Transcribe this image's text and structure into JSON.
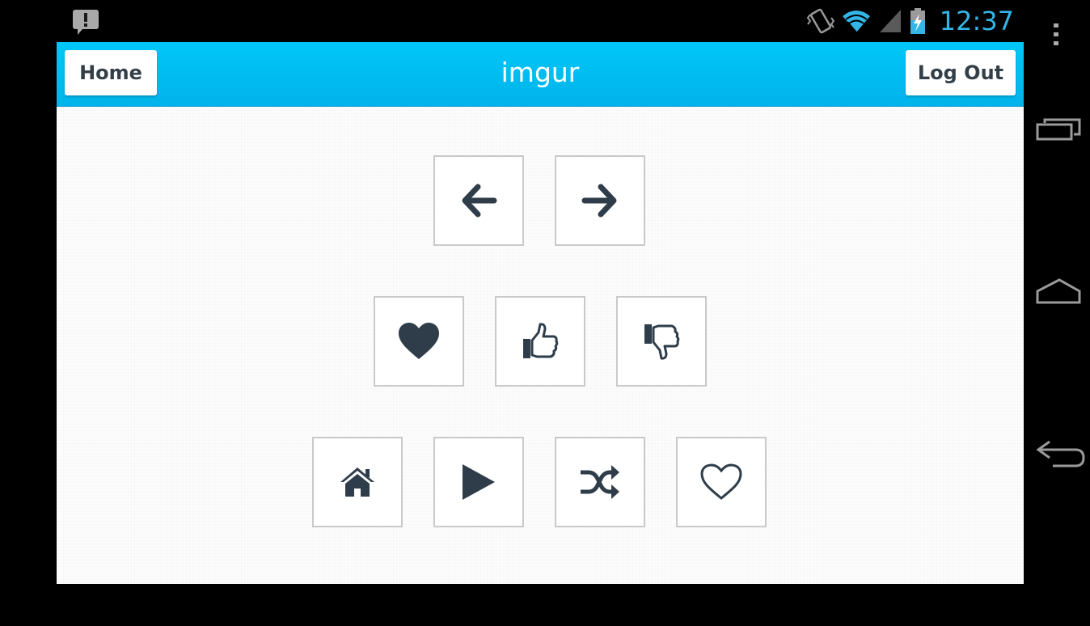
{
  "status_bar": {
    "time": "12:37",
    "accent_color": "#33b5e5",
    "icons": [
      "notification-alert-icon",
      "vibrate-icon",
      "wifi-icon",
      "signal-icon",
      "battery-charging-icon"
    ]
  },
  "header": {
    "title": "imgur",
    "home_label": "Home",
    "logout_label": "Log Out",
    "color": "#00bff2"
  },
  "tiles": {
    "row1": [
      "arrow-left-icon",
      "arrow-right-icon"
    ],
    "row2": [
      "heart-filled-icon",
      "thumbs-up-icon",
      "thumbs-down-icon"
    ],
    "row3": [
      "home-icon",
      "play-icon",
      "shuffle-icon",
      "heart-outline-icon"
    ],
    "icon_color": "#2e3d49"
  },
  "nav_bar": {
    "icons": [
      "overflow-menu-icon",
      "recent-apps-icon",
      "home-nav-icon",
      "back-icon"
    ]
  }
}
